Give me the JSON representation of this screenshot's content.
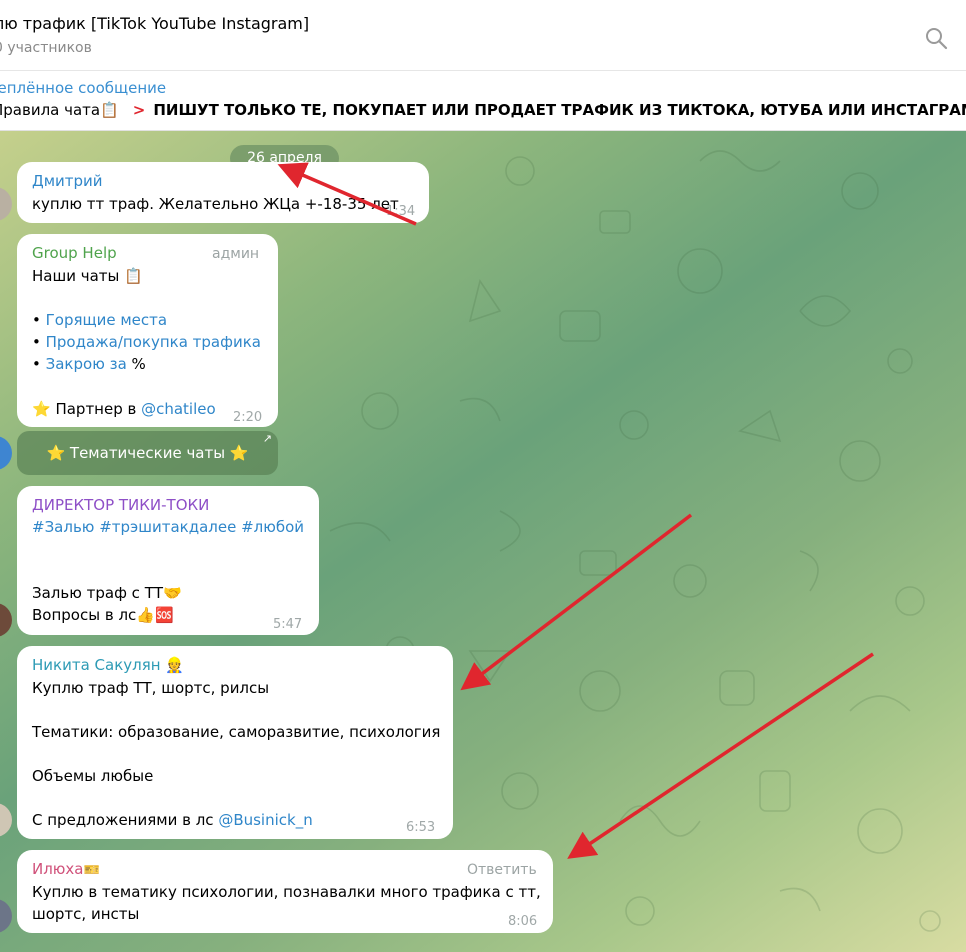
{
  "header": {
    "title": "лю трафик [TikTok YouTube Instagram]",
    "members": "0 участников",
    "search_icon": "search-icon"
  },
  "pinned": {
    "label": "реплённое сообщение",
    "rules": "Правила чата📋",
    "text": "ПИШУТ ТОЛЬКО ТЕ, ПОКУПАЕТ ИЛИ ПРОДАЕТ ТРАФИК ИЗ ТИКТОКА, ЮТУБА ИЛИ ИНСТАГРАМА",
    "arrow_glyph": ">"
  },
  "chat": {
    "date": "26 апреля",
    "messages": [
      {
        "name": "Дмитрий",
        "name_color": "#2f86c9",
        "text": "куплю тт траф. Желательно ЖЦа +-18-35 лет",
        "time": "1:34"
      },
      {
        "name": "Group Help",
        "name_color": "#4fa34c",
        "role": "админ",
        "lines": [
          "Наши чаты 📋",
          "",
          "• ",
          "Горящие места",
          "• ",
          "Продажа/покупка трафика",
          "• ",
          "Закрою за",
          " %",
          "⭐ Партнер в ",
          "@chatileo"
        ],
        "time": "2:20",
        "button": "⭐ Тематические чаты ⭐",
        "button_corner": "↗"
      },
      {
        "name": "ДИРЕКТОР ТИКИ-ТОКИ",
        "name_color": "#8e4fc7",
        "tags": "#Залью #трэшитакдалее #любой",
        "line1": "Залью траф с ТТ🤝",
        "line2": "Вопросы в лс👍🆘",
        "time": "5:47"
      },
      {
        "name": "Никита Сакулян 👷",
        "name_color": "#2e9bb5",
        "line1": "Куплю траф ТТ, шортс, рилсы",
        "line2": "Тематики: образование, саморазвитие, психология",
        "line3": "Объемы любые",
        "line4": "С предложениями в лс ",
        "mention": "@Businick_n",
        "time": "6:53"
      },
      {
        "name": "Илюха",
        "name_color": "#d0517a",
        "badge": "🎫",
        "reply": "Ответить",
        "line1": "Куплю в тематику психологии, познавалки много трафика с тт,",
        "line2": "шортс, инсты",
        "time": "8:06"
      }
    ]
  },
  "colors": {
    "accent": "#2f86c9",
    "annotation_arrow": "#e0262e"
  }
}
